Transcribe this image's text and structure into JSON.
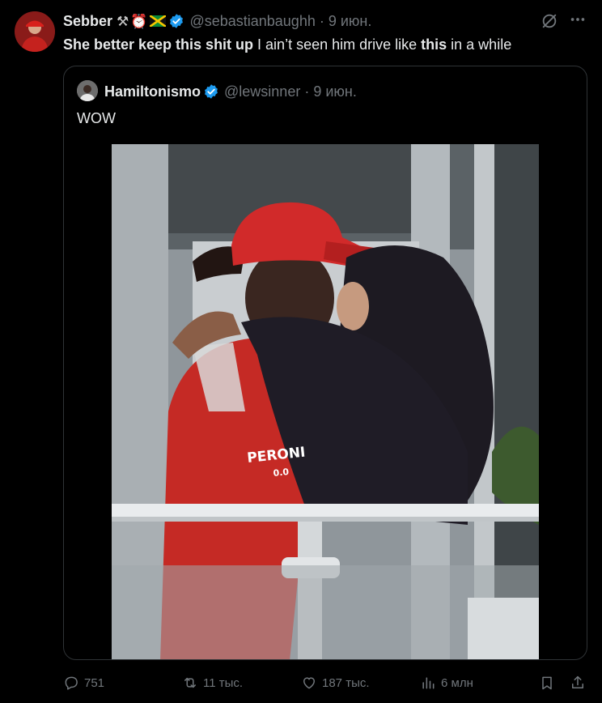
{
  "tweet": {
    "author_name": "Sebber",
    "author_handle": "@sebastianbaughh",
    "separator": "·",
    "date": "9 июн.",
    "badges": [
      "hammer-icon",
      "alarm-clock-icon",
      "jamaica-flag-icon",
      "verified-badge-icon"
    ],
    "text": {
      "part1": "She better keep this shit up",
      "part2": " I ain’t seen him drive like ",
      "part3": "this",
      "part4": " in a while"
    }
  },
  "quote": {
    "author_name": "Hamiltonismo",
    "author_handle": "@lewsinner",
    "separator": "·",
    "date": "9 июн.",
    "text": "WOW",
    "media": {
      "jersey_text": [
        "PERONI",
        "0.0"
      ]
    }
  },
  "actions": {
    "replies": "751",
    "retweets": "11 тыс.",
    "likes": "187 тыс.",
    "views": "6 млн"
  },
  "colors": {
    "background": "#000000",
    "text": "#e7e9ea",
    "muted": "#71767b",
    "border": "#2f3336",
    "verified": "#1d9bf0"
  }
}
